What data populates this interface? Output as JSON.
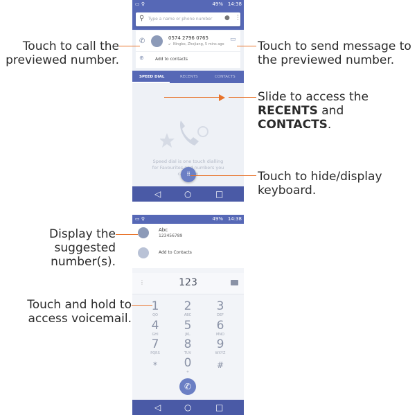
{
  "phone1": {
    "status_time": "14:38",
    "status_battery": "49%",
    "search_placeholder": "Type a name or phone number",
    "preview_number": "0574 2796 0765",
    "preview_location": "Ningbo, Zhejiang, 5 mins ago",
    "add_to_contacts": "Add to contacts",
    "tabs": [
      "SPEED DIAL",
      "RECENTS",
      "CONTACTS"
    ],
    "empty_text_lines": [
      "Speed dial is one touch dialling",
      "for Favourites and numbers you",
      "call often"
    ]
  },
  "phone2": {
    "status_time": "14:38",
    "status_battery": "49%",
    "suggestion_name": "Abc",
    "suggestion_number": "123456789",
    "add_to_contacts": "Add to Contacts",
    "dial_value": "123",
    "keys": [
      {
        "digit": "1",
        "letters": "QO"
      },
      {
        "digit": "2",
        "letters": "ABC"
      },
      {
        "digit": "3",
        "letters": "DEF"
      },
      {
        "digit": "4",
        "letters": "GHI"
      },
      {
        "digit": "5",
        "letters": "JKL"
      },
      {
        "digit": "6",
        "letters": "MNO"
      },
      {
        "digit": "7",
        "letters": "PQRS"
      },
      {
        "digit": "8",
        "letters": "TUV"
      },
      {
        "digit": "9",
        "letters": "WXYZ"
      },
      {
        "digit": "*",
        "letters": ""
      },
      {
        "digit": "0",
        "letters": "+"
      },
      {
        "digit": "#",
        "letters": ""
      }
    ]
  },
  "callouts": {
    "call_preview": [
      "Touch to call the",
      "previewed number."
    ],
    "send_message": [
      "Touch to send message to",
      "the previewed number."
    ],
    "slide_prefix": "Slide to access the",
    "slide_recents": "RECENTS",
    "slide_and": " and",
    "slide_contacts": "CONTACTS",
    "slide_period": ".",
    "keyboard": [
      "Touch to hide/display",
      "keyboard."
    ],
    "suggested": [
      "Display the",
      "suggested",
      "number(s)."
    ],
    "voicemail": [
      "Touch and hold to",
      "access voicemail."
    ]
  },
  "colors": {
    "accent": "#e8732a",
    "header": "#5668b6",
    "navbar": "#4a5aa6"
  }
}
